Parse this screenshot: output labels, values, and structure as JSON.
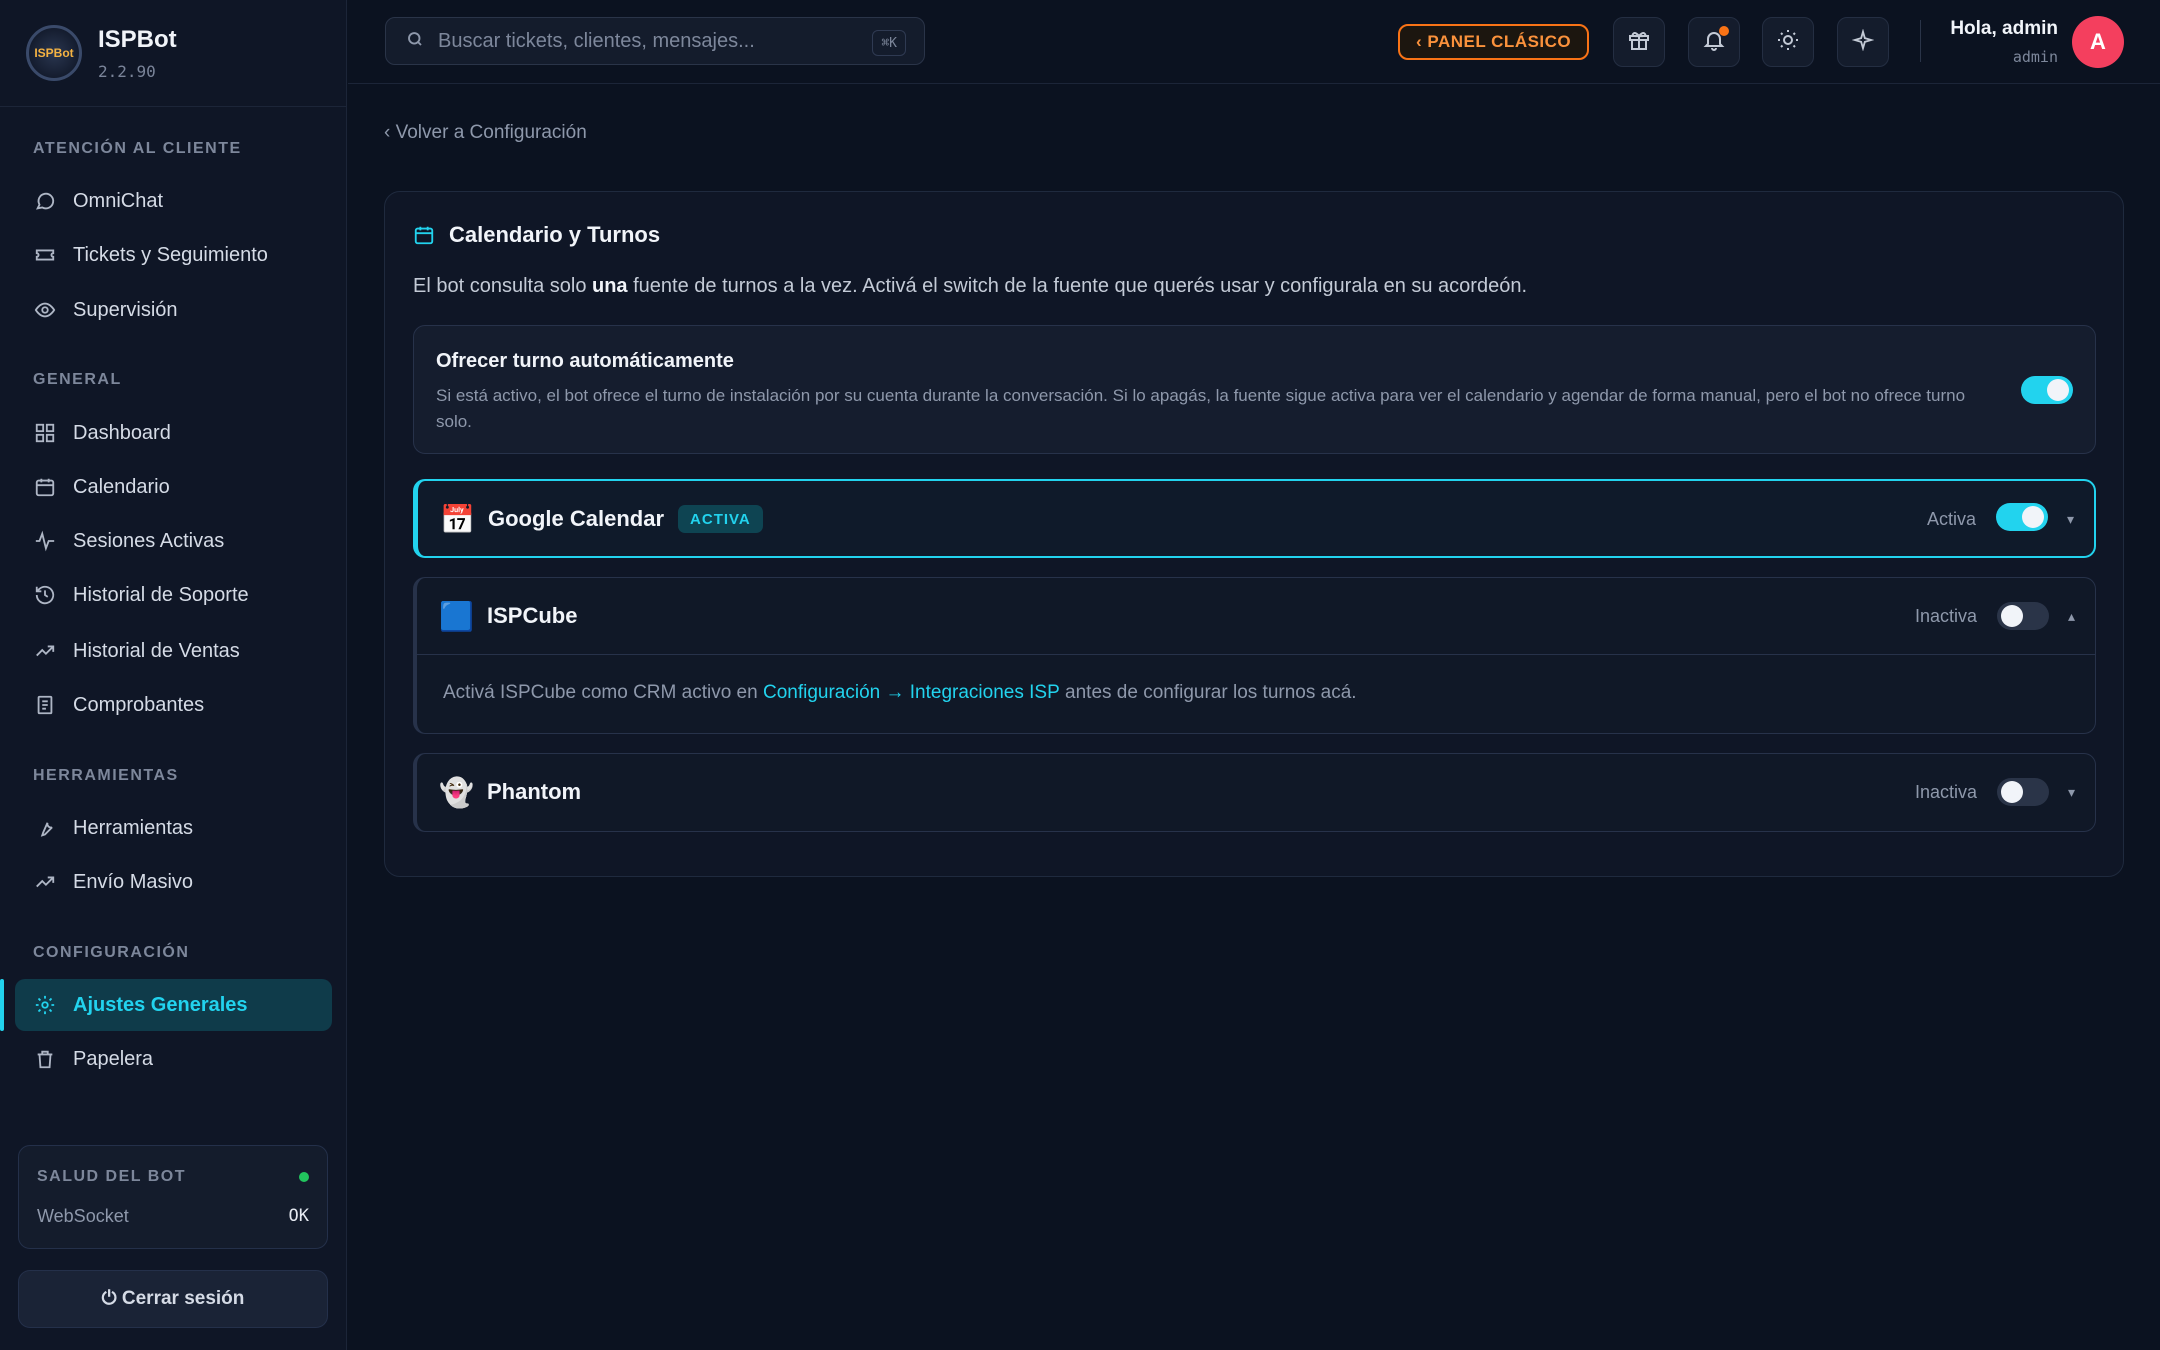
{
  "app": {
    "name": "ISPBot",
    "version": "2.2.90",
    "logo_text": "ISPBot"
  },
  "sidebar": {
    "sections": [
      {
        "title": "ATENCIÓN AL CLIENTE"
      },
      {
        "title": "GENERAL"
      },
      {
        "title": "HERRAMIENTAS"
      },
      {
        "title": "CONFIGURACIÓN"
      }
    ],
    "items": [
      {
        "label": "OmniChat",
        "icon": "chat-icon"
      },
      {
        "label": "Tickets y Seguimiento",
        "icon": "ticket-icon"
      },
      {
        "label": "Supervisión",
        "icon": "eye-icon"
      },
      {
        "label": "Dashboard",
        "icon": "grid-icon"
      },
      {
        "label": "Calendario",
        "icon": "calendar-icon"
      },
      {
        "label": "Sesiones Activas",
        "icon": "activity-icon"
      },
      {
        "label": "Historial de Soporte",
        "icon": "history-icon"
      },
      {
        "label": "Historial de Ventas",
        "icon": "trend-icon"
      },
      {
        "label": "Comprobantes",
        "icon": "receipt-icon"
      },
      {
        "label": "Herramientas",
        "icon": "wrench-icon"
      },
      {
        "label": "Envío Masivo",
        "icon": "trend-icon"
      },
      {
        "label": "Ajustes Generales",
        "icon": "gear-icon",
        "active": true
      },
      {
        "label": "Papelera",
        "icon": "trash-icon"
      }
    ],
    "health": {
      "title": "SALUD DEL BOT",
      "label": "WebSocket",
      "value": "OK",
      "status_color": "#22c55e"
    },
    "logout_label": "⏻ Cerrar sesión"
  },
  "topbar": {
    "search_placeholder": "Buscar tickets, clientes, mensajes...",
    "shortcut": "⌘K",
    "classic_label": "‹  PANEL CLÁSICO",
    "greeting": "Hola, admin",
    "role": "admin",
    "avatar_letter": "A"
  },
  "main": {
    "back_label": "‹ Volver a Configuración",
    "title": "Calendario y Turnos",
    "desc_pre": "El bot consulta solo ",
    "desc_bold": "una",
    "desc_post": " fuente de turnos a la vez. Activá el switch de la fuente que querés usar y configurala en su acordeón.",
    "auto": {
      "title": "Ofrecer turno automáticamente",
      "desc": "Si está activo, el bot ofrece el turno de instalación por su cuenta durante la conversación. Si lo apagás, la fuente sigue activa para ver el calendario y agendar de forma manual, pero el bot no ofrece turno solo.",
      "enabled": true
    },
    "sources": [
      {
        "emoji": "📅",
        "name": "Google Calendar",
        "badge": "ACTIVA",
        "status": "Activa",
        "enabled": true,
        "chevron": "▾"
      },
      {
        "emoji": "🟦",
        "name": "ISPCube",
        "status": "Inactiva",
        "enabled": false,
        "chevron": "▴",
        "body_pre": "Activá ISPCube como CRM activo en ",
        "body_link": "Configuración → Integraciones ISP",
        "body_post": " antes de configurar los turnos acá."
      },
      {
        "emoji": "👻",
        "name": "Phantom",
        "status": "Inactiva",
        "enabled": false,
        "chevron": "▾"
      }
    ]
  },
  "colors": {
    "accent": "#22d3ee",
    "warning": "#f97316",
    "avatar": "#f43f5e"
  }
}
